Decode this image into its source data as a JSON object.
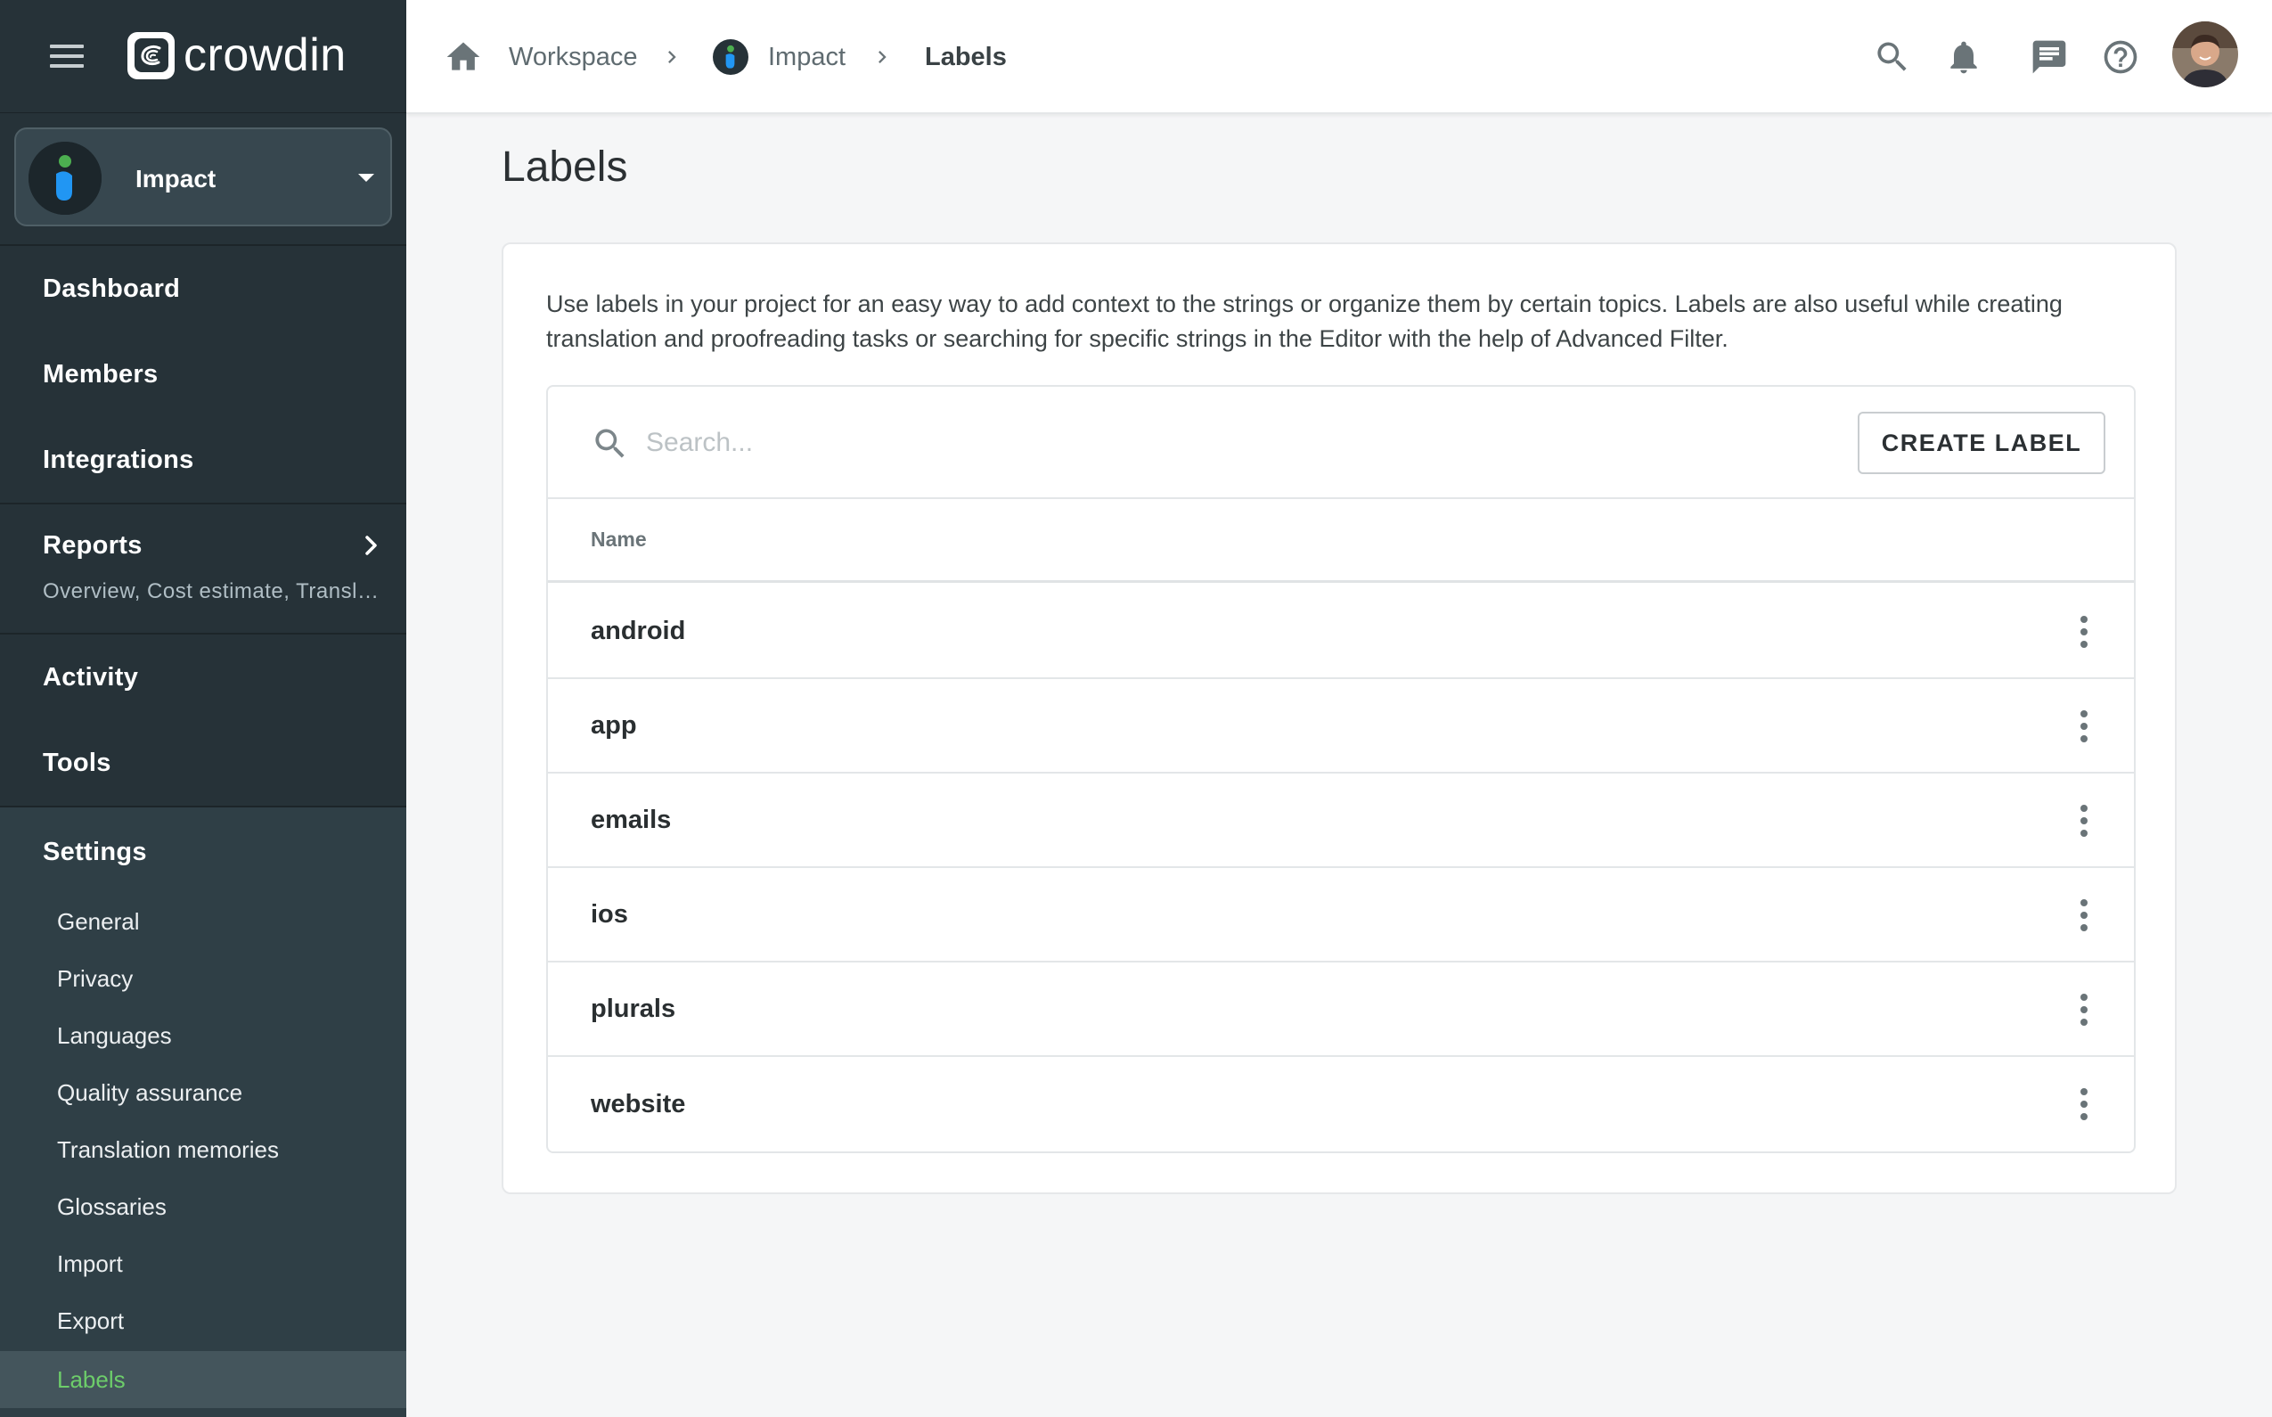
{
  "app": {
    "brand": "crowdin",
    "accent_color": "#6dcd6a",
    "sidebar_bg": "#263238"
  },
  "project_switcher": {
    "name": "Impact",
    "icon": "impact-project-icon"
  },
  "sidebar": {
    "items": [
      {
        "label": "Dashboard"
      },
      {
        "label": "Members"
      },
      {
        "label": "Integrations"
      },
      {
        "label": "Reports",
        "subtitle": "Overview, Cost estimate, Transl…"
      },
      {
        "label": "Activity"
      },
      {
        "label": "Tools"
      },
      {
        "label": "Settings"
      }
    ],
    "settings_items": [
      {
        "label": "General"
      },
      {
        "label": "Privacy"
      },
      {
        "label": "Languages"
      },
      {
        "label": "Quality assurance"
      },
      {
        "label": "Translation memories"
      },
      {
        "label": "Glossaries"
      },
      {
        "label": "Import"
      },
      {
        "label": "Export"
      },
      {
        "label": "Labels",
        "active": true
      }
    ]
  },
  "breadcrumb": {
    "home_icon": "home-icon",
    "workspace": "Workspace",
    "project": "Impact",
    "current": "Labels"
  },
  "header_icons": [
    "search-icon",
    "bell-icon",
    "chat-icon",
    "help-icon"
  ],
  "main": {
    "title": "Labels",
    "description": "Use labels in your project for an easy way to add context to the strings or organize them by certain topics. Labels are also useful while creating translation and proofreading tasks or searching for specific strings in the Editor with the help of Advanced Filter.",
    "search": {
      "placeholder": "Search...",
      "value": ""
    },
    "create_button": "CREATE LABEL",
    "column_header": "Name",
    "labels": [
      "android",
      "app",
      "emails",
      "ios",
      "plurals",
      "website"
    ]
  }
}
